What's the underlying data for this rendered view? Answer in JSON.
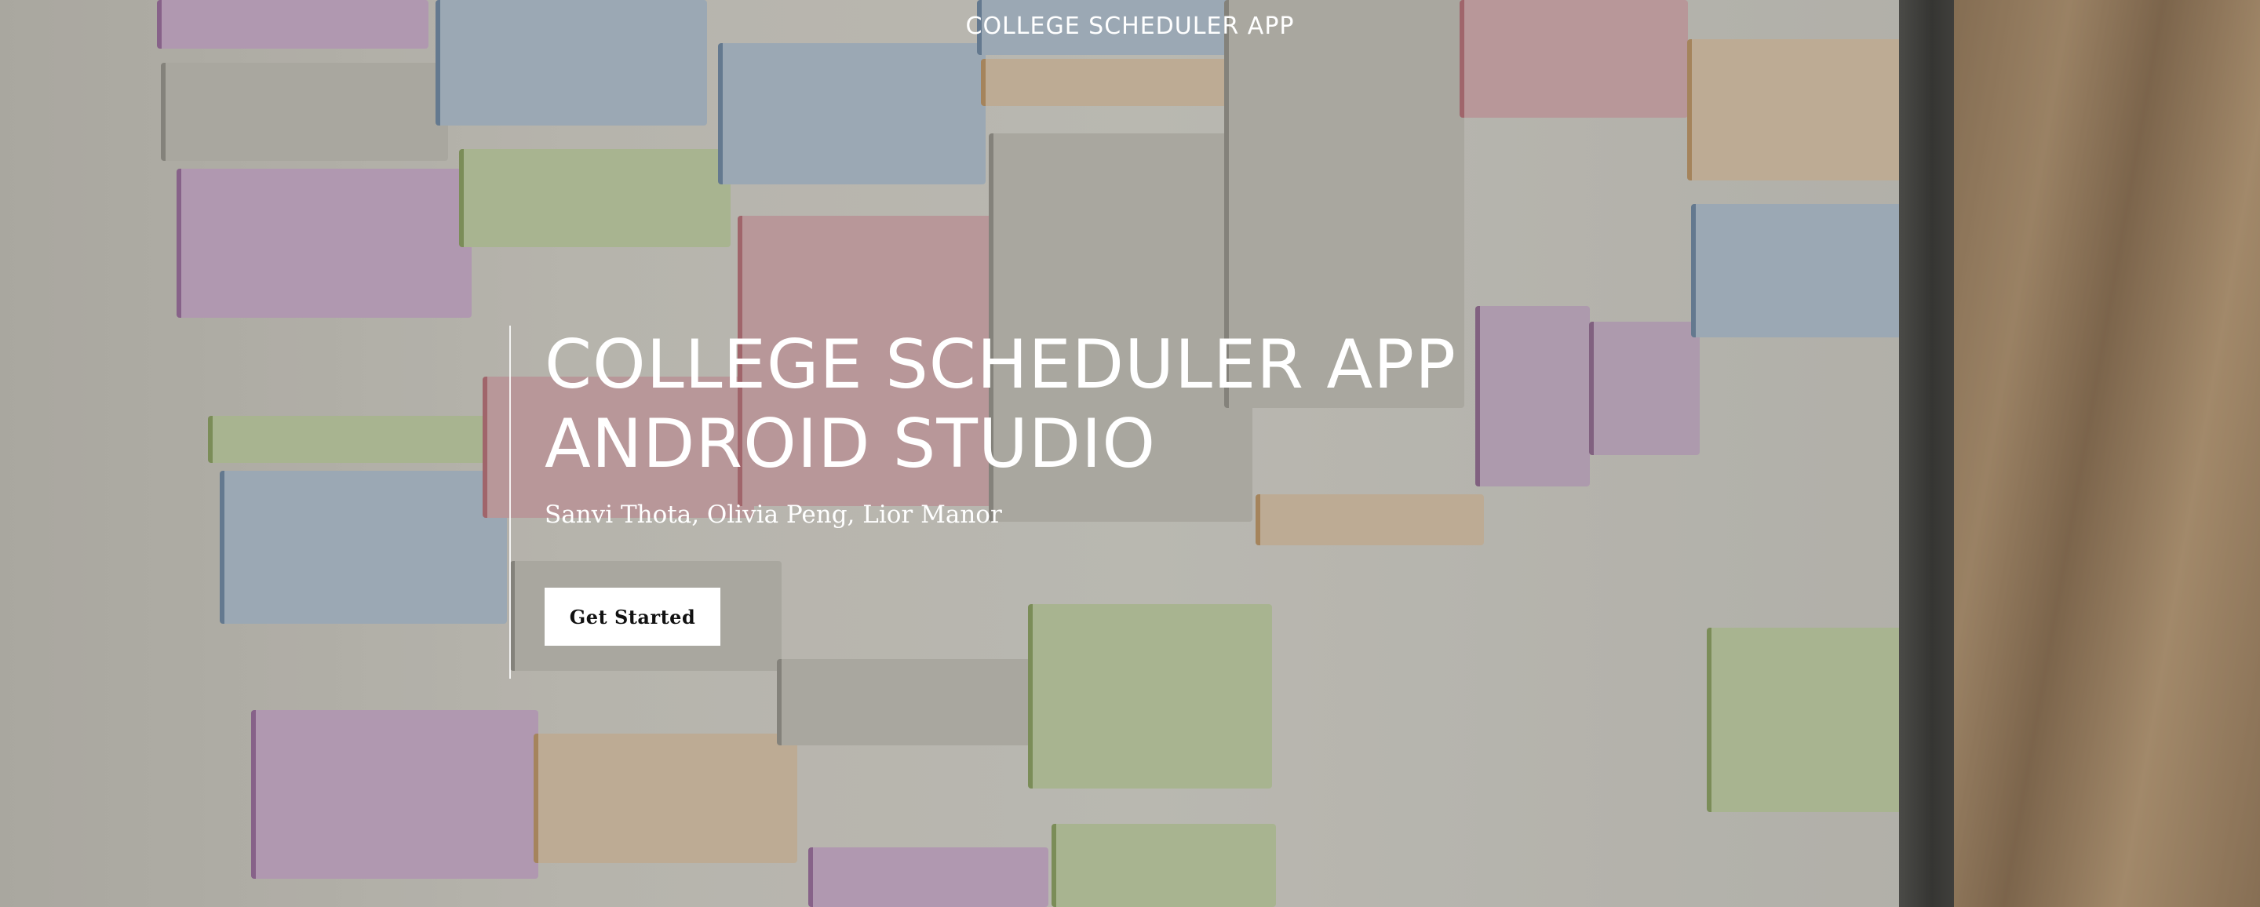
{
  "header": {
    "site_title": "COLLEGE SCHEDULER APP"
  },
  "hero": {
    "headline_line1": "COLLEGE SCHEDULER APP",
    "headline_line2": "ANDROID STUDIO",
    "authors": "Sanvi Thota, Olivia Peng, Lior Manor",
    "cta_label": "Get Started"
  }
}
